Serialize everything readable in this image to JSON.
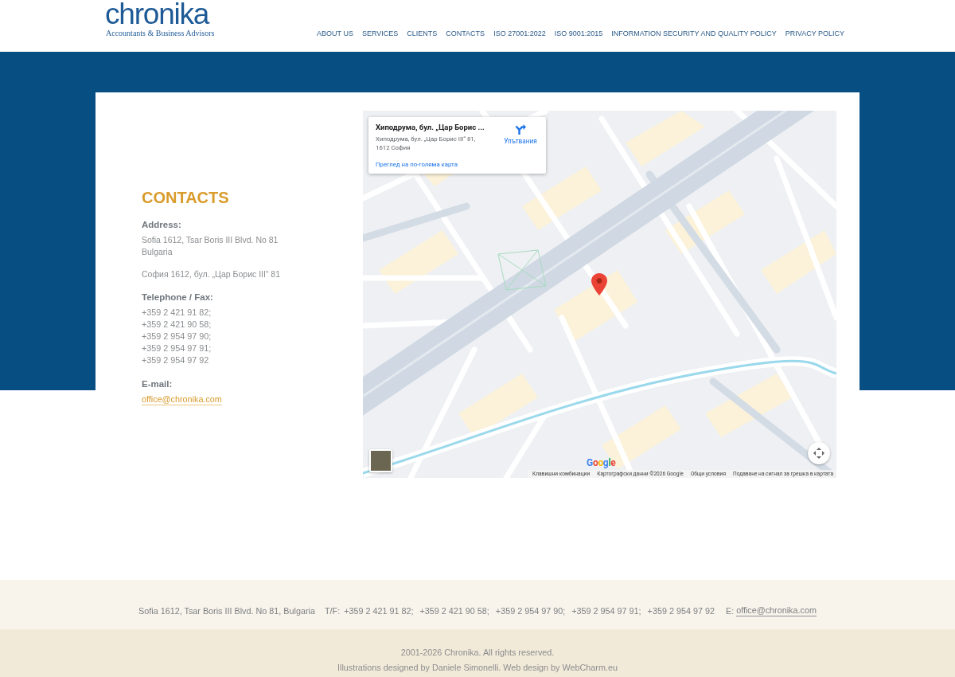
{
  "header": {
    "logo": {
      "wordmark": "chronika",
      "tagline": "Accountants & Business Advisors"
    },
    "nav": [
      {
        "label": "ABOUT US"
      },
      {
        "label": "SERVICES"
      },
      {
        "label": "CLIENTS"
      },
      {
        "label": "CONTACTS"
      },
      {
        "label": "ISO 27001:2022"
      },
      {
        "label": "ISO 9001:2015"
      },
      {
        "label": "INFORMATION SECURITY AND QUALITY POLICY"
      },
      {
        "label": "PRIVACY POLICY"
      }
    ]
  },
  "contacts": {
    "title": "CONTACTS",
    "address_label": "Address:",
    "address_lines": [
      "Sofia 1612, Tsar Boris III Blvd. No 81",
      "Bulgaria"
    ],
    "address_local": "София 1612, бул. „Цар Борис III“ 81",
    "phone_label": "Telephone / Fax:",
    "phones": [
      "+359 2 421 91 82;",
      "+359 2 421 90 58;",
      "+359 2 954 97 90;",
      "+359 2 954 97 91;",
      "+359 2 954 97 92"
    ],
    "email_label": "E-mail:",
    "email": "office@chronika.com"
  },
  "map": {
    "info_card": {
      "title": "Хиподрума, бул. „Цар Борис ...",
      "address_lines": [
        "Хиподрума, бул. „Цар Борис III“ 81,",
        "1612 София"
      ],
      "directions": "Упътвания",
      "larger_map_link": "Преглед на по-голяма карта"
    },
    "google_logo": "Google",
    "attribution": [
      "Клавишни комбинации",
      "Картографски данни ©2026 Google",
      "Общи условия",
      "Подаване на сигнал за грешка в картата"
    ]
  },
  "footer": {
    "address": "Sofia 1612, Tsar Boris III Blvd. No 81, Bulgaria",
    "phone_label": "T/F:",
    "phones": [
      "+359 2 421 91 82;",
      "+359 2 421 90 58;",
      "+359 2 954 97 90;",
      "+359 2 954 97 91;",
      "+359 2 954 97 92"
    ],
    "email_label": "E:",
    "email": "office@chronika.com"
  },
  "bottom_bar": {
    "copyright": "2001-2026 Chronika. All rights reserved.",
    "credits": "Illustrations designed by Daniele Simonelli. Web design by WebCharm.eu"
  }
}
